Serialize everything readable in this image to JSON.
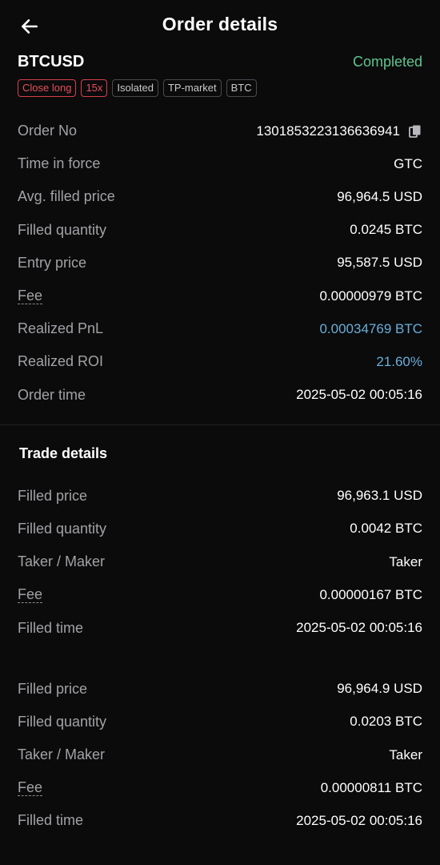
{
  "header": {
    "title": "Order details"
  },
  "summary": {
    "symbol": "BTCUSD",
    "status": "Completed",
    "tags": [
      "Close long",
      "15x",
      "Isolated",
      "TP-market",
      "BTC"
    ]
  },
  "order": {
    "order_no_label": "Order No",
    "order_no": "1301853223136636941",
    "time_in_force_label": "Time in force",
    "time_in_force": "GTC",
    "avg_price_label": "Avg. filled price",
    "avg_price": "96,964.5 USD",
    "filled_qty_label": "Filled quantity",
    "filled_qty": "0.0245 BTC",
    "entry_price_label": "Entry price",
    "entry_price": "95,587.5 USD",
    "fee_label": "Fee",
    "fee": "0.00000979 BTC",
    "pnl_label": "Realized PnL",
    "pnl": "0.00034769 BTC",
    "roi_label": "Realized ROI",
    "roi": "21.60%",
    "order_time_label": "Order time",
    "order_time": "2025-05-02 00:05:16"
  },
  "trades": {
    "title": "Trade details",
    "items": [
      {
        "price_label": "Filled price",
        "price": "96,963.1 USD",
        "qty_label": "Filled quantity",
        "qty": "0.0042 BTC",
        "role_label": "Taker / Maker",
        "role": "Taker",
        "fee_label": "Fee",
        "fee": "0.00000167 BTC",
        "time_label": "Filled time",
        "time": "2025-05-02 00:05:16"
      },
      {
        "price_label": "Filled price",
        "price": "96,964.9 USD",
        "qty_label": "Filled quantity",
        "qty": "0.0203 BTC",
        "role_label": "Taker / Maker",
        "role": "Taker",
        "fee_label": "Fee",
        "fee": "0.00000811 BTC",
        "time_label": "Filled time",
        "time": "2025-05-02 00:05:16"
      }
    ]
  },
  "colors": {
    "background": "#0b0b0c",
    "completed": "#5fc48f",
    "profit": "#6aaed8",
    "close_long": "#e8505a"
  },
  "icons": {
    "back": "back-arrow-icon",
    "copy": "copy-icon"
  }
}
